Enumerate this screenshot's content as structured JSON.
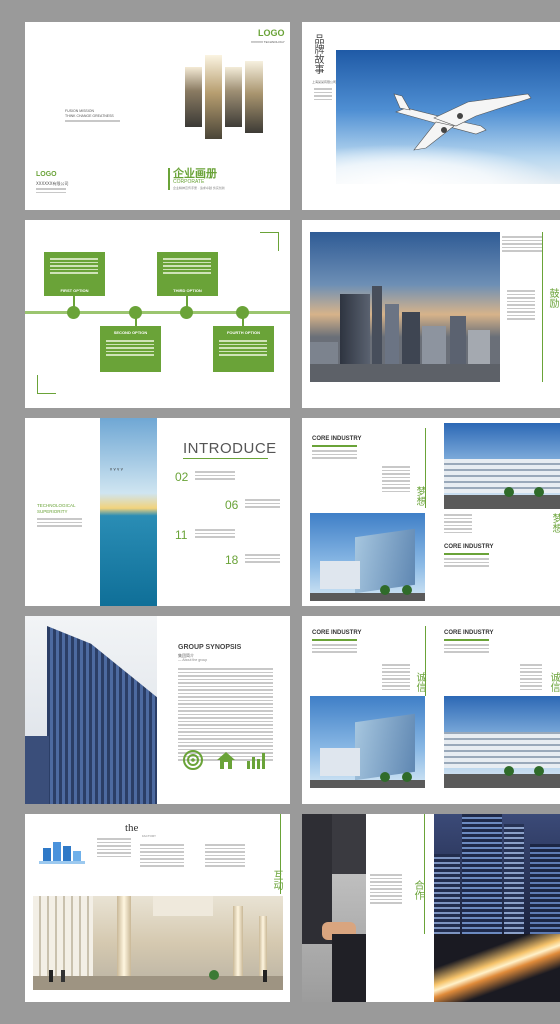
{
  "colors": {
    "accent": "#6aa338",
    "frame": "#9a9a9a"
  },
  "cover": {
    "logo_top": "LOGO",
    "logo_top_sub": "XXXXXX TECHNOLOGY",
    "small_caption_1": "FUSION MISSION",
    "small_caption_2": "THINK CHANGE GREATNESS",
    "logo_bottom": "LOGO",
    "company": "XXXXXX有限公司",
    "title_cn": "企业画册",
    "title_en": "CORPORATE",
    "tagline": "企业精神宣传手册 · 追求卓越 务实创新"
  },
  "page_story": {
    "title_vertical": "品牌故事",
    "sub": "上海某某有限公司"
  },
  "timeline": {
    "options": [
      "FIRST OPTION",
      "SECOND OPTION",
      "THIRD OPTION",
      "FOURTH OPTION"
    ]
  },
  "page_city": {
    "vertical": "鼓励"
  },
  "page_introduce": {
    "heading": "INTRODUCE",
    "side_title": "TECHNOLOGICAL SUPERIORITY",
    "numbers": [
      "02",
      "06",
      "11",
      "18"
    ]
  },
  "page_core1": {
    "title_a": "CORE INDUSTRY",
    "vert_a": "梦想",
    "title_b": "CORE INDUSTRY",
    "vert_b": "梦想"
  },
  "page_group": {
    "title": "GROUP SYNOPSIS",
    "sub": "集团简介",
    "sub2": "— About the group"
  },
  "page_core2": {
    "title_a": "CORE INDUSTRY",
    "vert_a": "诚信",
    "title_b": "CORE INDUSTRY",
    "vert_b": "诚信"
  },
  "page_the": {
    "the": "the",
    "small": "FACTORY",
    "vert": "互动"
  },
  "page_coop": {
    "vert": "合作"
  },
  "icons": [
    "target-icon",
    "house-icon",
    "bar-chart-icon",
    "airplane-icon",
    "handshake-icon"
  ]
}
